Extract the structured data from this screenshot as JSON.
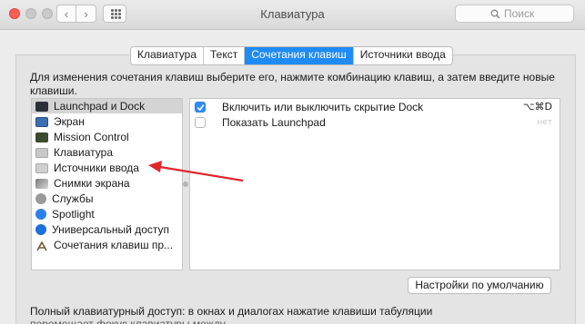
{
  "window": {
    "title": "Клавиатура",
    "search_placeholder": "Поиск"
  },
  "tabs": [
    {
      "label": "Клавиатура",
      "active": false
    },
    {
      "label": "Текст",
      "active": false
    },
    {
      "label": "Сочетания клавиш",
      "active": true
    },
    {
      "label": "Источники ввода",
      "active": false
    }
  ],
  "description": "Для изменения сочетания клавиш выберите его, нажмите комбинацию клавиш, а затем введите новые клавиши.",
  "categories": [
    {
      "label": "Launchpad и Dock",
      "icon": "launchpad-dock-icon",
      "selected": true
    },
    {
      "label": "Экран",
      "icon": "display-icon",
      "selected": false
    },
    {
      "label": "Mission Control",
      "icon": "mission-control-icon",
      "selected": false
    },
    {
      "label": "Клавиатура",
      "icon": "keyboard-icon",
      "selected": false
    },
    {
      "label": "Источники ввода",
      "icon": "input-sources-icon",
      "selected": false
    },
    {
      "label": "Снимки экрана",
      "icon": "screenshot-icon",
      "selected": false
    },
    {
      "label": "Службы",
      "icon": "services-gear-icon",
      "selected": false
    },
    {
      "label": "Spotlight",
      "icon": "spotlight-icon",
      "selected": false
    },
    {
      "label": "Универсальный доступ",
      "icon": "accessibility-icon",
      "selected": false
    },
    {
      "label": "Сочетания клавиш пр...",
      "icon": "app-shortcuts-icon",
      "selected": false
    }
  ],
  "shortcuts": [
    {
      "checked": true,
      "label": "Включить или выключить скрытие Dock",
      "keys": "⌥⌘D",
      "dim": false
    },
    {
      "checked": false,
      "label": "Показать Launchpad",
      "keys": "нет",
      "dim": true
    }
  ],
  "default_button": "Настройки по умолчанию",
  "footer": "Полный клавиатурный доступ: в окнах и диалогах нажатие клавиши табуляции",
  "footer_partial": "перемещает фокус клавиатуры между",
  "colors": {
    "accent": "#1f8bf6",
    "annotation_arrow": "#e0262b"
  }
}
